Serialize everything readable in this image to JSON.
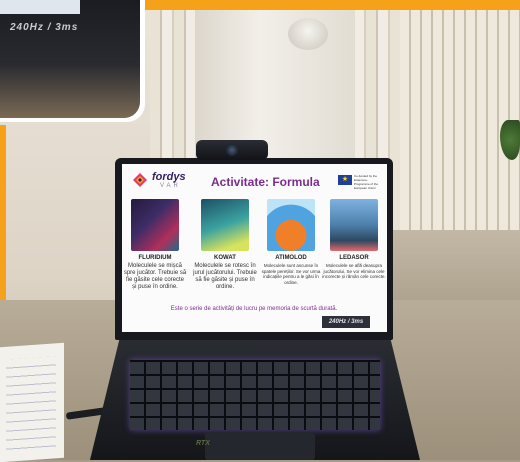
{
  "inset": {
    "model_label": "240Hz / 3ms"
  },
  "slide": {
    "brand": "fordys",
    "brand_sub": "VAR",
    "title": "Activitate: Formula",
    "eu_text": "Co-funded by the Erasmus+ Programme of the European Union",
    "cards": [
      {
        "title": "FLURIDIUM",
        "text": "Moleculele se mișcă spre jucător. Trebuie să fie găsite cele corecte și puse în ordine."
      },
      {
        "title": "KOWAT",
        "text": "Moleculele se rotesc în jurul jucătorului. Trebuie să fie găsite și puse în ordine."
      },
      {
        "title": "ATIMOLOD",
        "text": "Moleculele sunt ascunse în spatele pereților. Se vor urma indicațiile pentru a le găsi în ordine."
      },
      {
        "title": "LEDASOR",
        "text": "Moleculele se află deasupra jucătorului. Se vor elimina cele incorecte și rămân cele corecte."
      }
    ],
    "footer": "Este o serie de activități de lucru pe memoria de scurtă durată."
  },
  "laptop": {
    "badge": "240Hz / 3ms",
    "keyboard_logo": "RTX"
  },
  "colors": {
    "accent_orange": "#f5a21a",
    "title_purple": "#7b2d8c",
    "brand_navy": "#352060"
  }
}
